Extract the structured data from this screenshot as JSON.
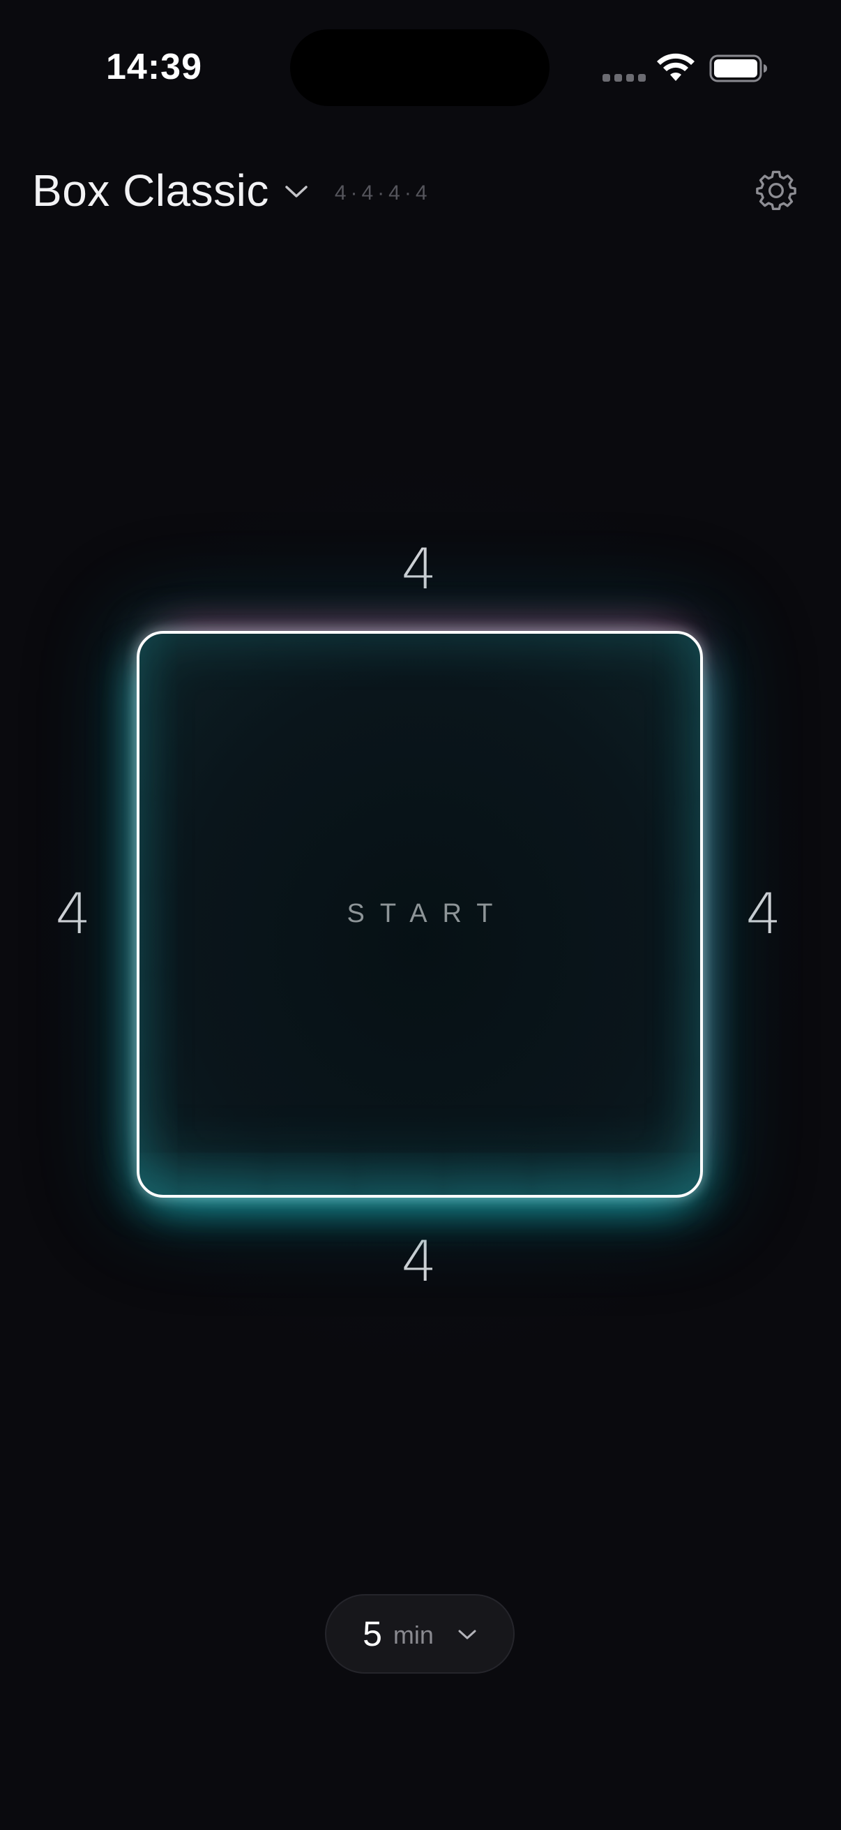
{
  "status_bar": {
    "time": "14:39",
    "icons": [
      "cellular-signal-icon",
      "wifi-icon",
      "battery-icon"
    ]
  },
  "header": {
    "preset_title": "Box Classic",
    "preset_pattern": "4·4·4·4",
    "icons": [
      "chevron-down-icon",
      "gear-icon"
    ]
  },
  "breathing_box": {
    "top_count": "4",
    "right_count": "4",
    "bottom_count": "4",
    "left_count": "4",
    "center_label": "START"
  },
  "duration": {
    "value": "5",
    "unit": "min",
    "icon": "chevron-down-icon"
  },
  "colors": {
    "background": "#0a0a0e",
    "accent_teal": "#1ec8d2",
    "accent_magenta": "#c82870",
    "box_stroke": "#ffffff"
  }
}
